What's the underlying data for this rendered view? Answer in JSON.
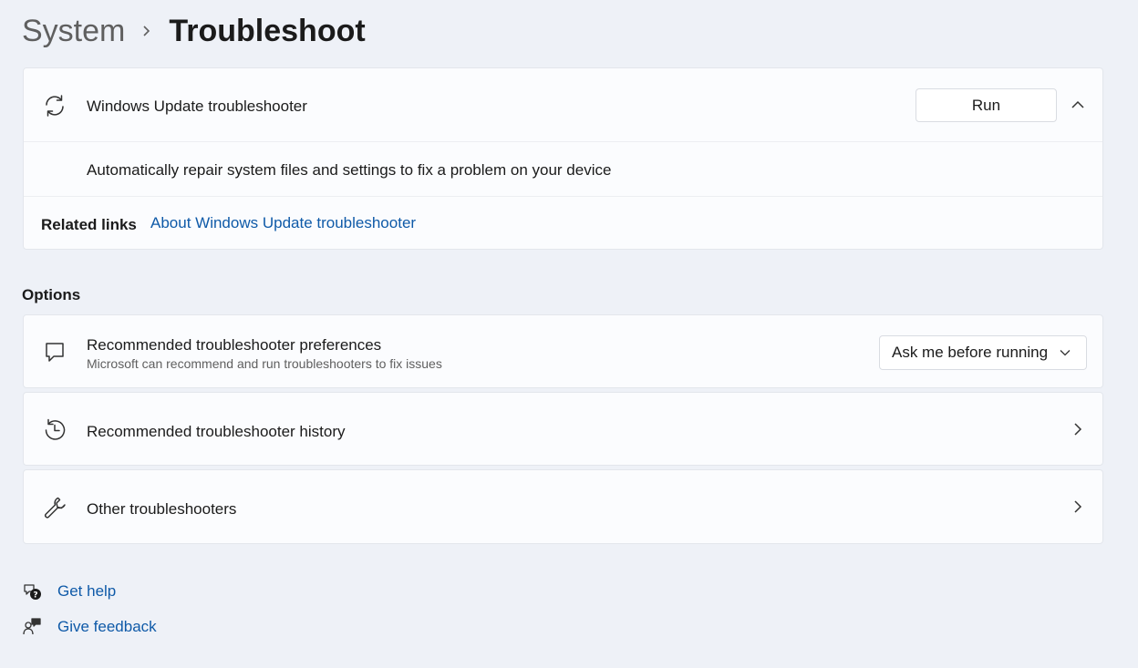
{
  "breadcrumb": {
    "parent": "System",
    "current": "Troubleshoot"
  },
  "windows_update": {
    "title": "Windows Update troubleshooter",
    "run_label": "Run",
    "description": "Automatically repair system files and settings to fix a problem on your device",
    "related_label": "Related links",
    "related_link": "About Windows Update troubleshooter",
    "icon": "sync-icon"
  },
  "options": {
    "section_label": "Options",
    "items": [
      {
        "title": "Recommended troubleshooter preferences",
        "subtitle": "Microsoft can recommend and run troubleshooters to fix issues",
        "dropdown_value": "Ask me before running",
        "icon": "chat-bubble-icon"
      },
      {
        "title": "Recommended troubleshooter history",
        "icon": "history-icon"
      },
      {
        "title": "Other troubleshooters",
        "icon": "wrench-icon"
      }
    ]
  },
  "footer": {
    "get_help": "Get help",
    "give_feedback": "Give feedback"
  },
  "colors": {
    "background": "#eef1f7",
    "card": "#fbfcfe",
    "link": "#0f5aa8"
  }
}
